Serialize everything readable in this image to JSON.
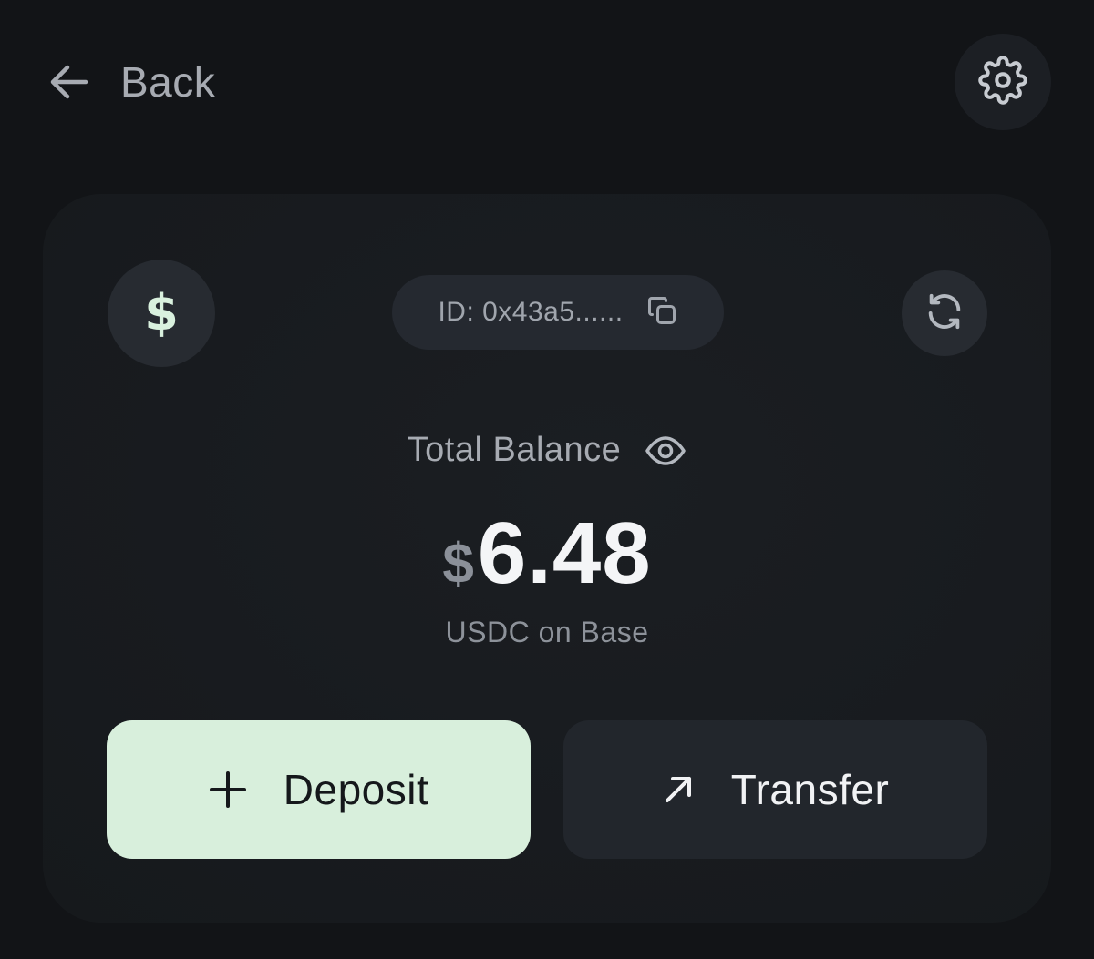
{
  "header": {
    "back_label": "Back",
    "back_icon": "arrow-left-icon",
    "settings_icon": "gear-icon"
  },
  "wallet": {
    "coin_symbol": "$",
    "id_label": "ID: 0x43a5......",
    "copy_icon": "copy-icon",
    "refresh_icon": "refresh-icon"
  },
  "balance": {
    "label": "Total Balance",
    "visibility_icon": "eye-icon",
    "currency_symbol": "$",
    "amount": "6.48",
    "network": "USDC on Base"
  },
  "actions": {
    "deposit_label": "Deposit",
    "deposit_icon": "plus-icon",
    "transfer_label": "Transfer",
    "transfer_icon": "arrow-up-right-icon"
  },
  "colors": {
    "background": "#121417",
    "card": "#181b1f",
    "accent_green": "#d8efdc",
    "text_primary": "#f4f5f7",
    "text_muted": "#a7abb2"
  }
}
